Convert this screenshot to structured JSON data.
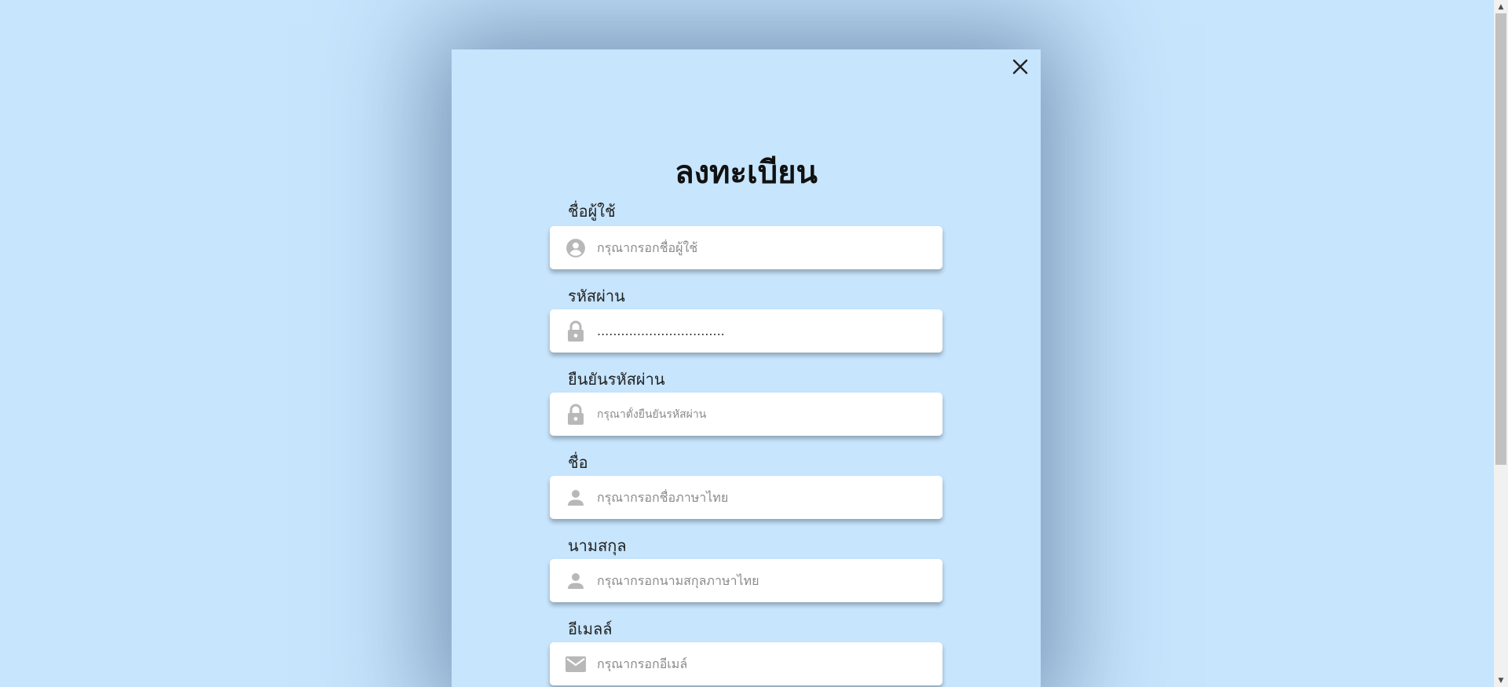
{
  "modal": {
    "title": "ลงทะเบียน",
    "close_icon": "close-icon"
  },
  "fields": {
    "username": {
      "label": "ชื่อผู้ใช้",
      "placeholder": "กรุณากรอกชื่อผู้ใช้",
      "value": "",
      "icon": "account-circle-icon"
    },
    "password": {
      "label": "รหัสผ่าน",
      "placeholder": "",
      "value": "................................",
      "icon": "lock-icon"
    },
    "confirm_password": {
      "label": "ยืนยันรหัสผ่าน",
      "placeholder": "กรุณาตั้งยืนยันรหัสผ่าน",
      "value": "",
      "icon": "lock-icon"
    },
    "first_name": {
      "label": "ชื่อ",
      "placeholder": "กรุณากรอกชื่อภาษาไทย",
      "value": "",
      "icon": "person-icon"
    },
    "last_name": {
      "label": "นามสกุล",
      "placeholder": "กรุณากรอกนามสกุลภาษาไทย",
      "value": "",
      "icon": "person-icon"
    },
    "email": {
      "label": "อีเมลล์",
      "placeholder": "กรุณากรอกอีเมล์",
      "value": "",
      "icon": "mail-icon"
    }
  },
  "colors": {
    "background": "#c7e5fd",
    "icon_gray": "#b8b8b8",
    "text_dark": "#111111"
  }
}
